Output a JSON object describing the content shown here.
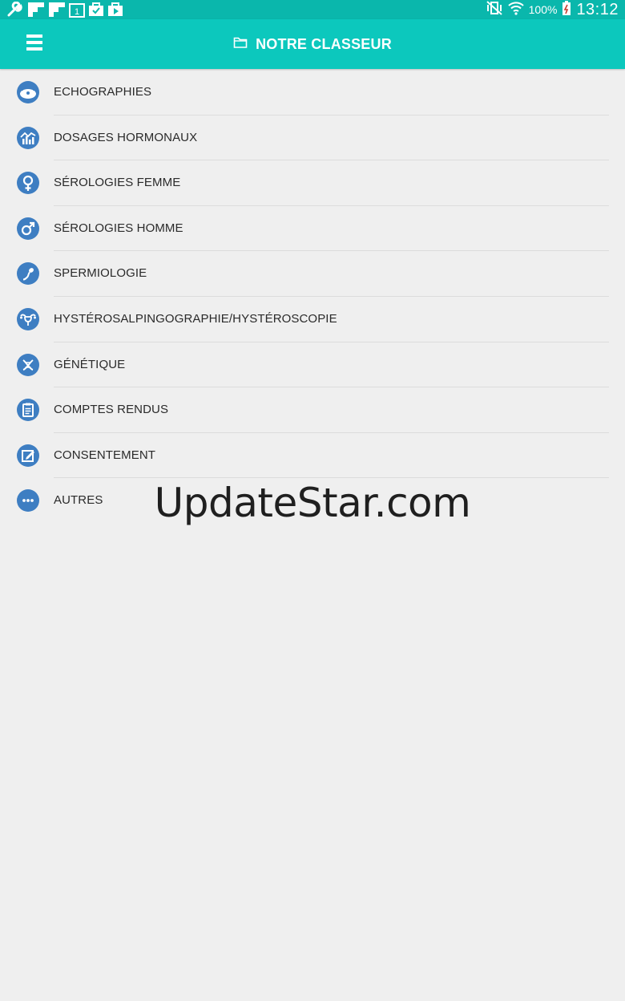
{
  "status_bar": {
    "battery_text": "100%",
    "time": "13:12",
    "notification_icons": [
      "wrench-icon",
      "flipboard-icon",
      "flipboard-icon",
      "calendar-icon",
      "briefcase-check-icon",
      "briefcase-play-icon"
    ],
    "background": "#0ab7ac"
  },
  "app_bar": {
    "title": "NOTRE CLASSEUR",
    "background": "#0cc8bd",
    "menu_icon": "hamburger-menu-icon",
    "title_icon": "folder-icon"
  },
  "list": {
    "icon_color": "#3e7ec2",
    "items": [
      {
        "label": "ECHOGRAPHIES",
        "icon": "ultrasound-icon"
      },
      {
        "label": "DOSAGES HORMONAUX",
        "icon": "chart-icon"
      },
      {
        "label": "SÉROLOGIES FEMME",
        "icon": "female-icon"
      },
      {
        "label": "SÉROLOGIES HOMME",
        "icon": "male-icon"
      },
      {
        "label": "SPERMIOLOGIE",
        "icon": "sperm-icon"
      },
      {
        "label": "HYSTÉROSALPINGOGRAPHIE/HYSTÉROSCOPIE",
        "icon": "uterus-icon"
      },
      {
        "label": "GÉNÉTIQUE",
        "icon": "dna-icon"
      },
      {
        "label": "COMPTES RENDUS",
        "icon": "clipboard-icon"
      },
      {
        "label": "CONSENTEMENT",
        "icon": "edit-icon"
      },
      {
        "label": "AUTRES",
        "icon": "more-icon"
      }
    ]
  },
  "watermark": "UpdateStar.com"
}
